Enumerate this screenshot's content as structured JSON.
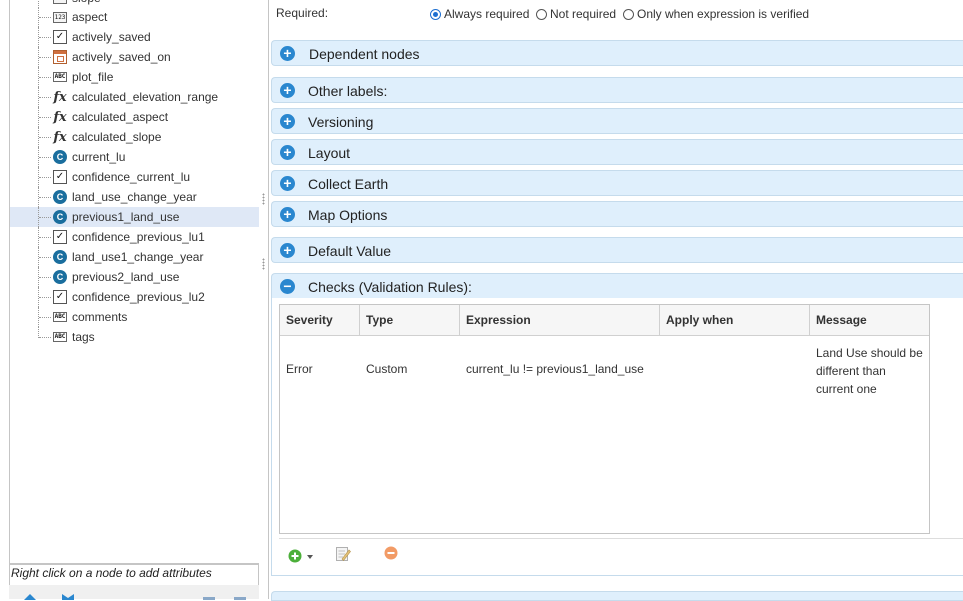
{
  "tree": {
    "items": [
      {
        "label": "slope",
        "icon": "number-icon"
      },
      {
        "label": "aspect",
        "icon": "number-icon"
      },
      {
        "label": "actively_saved",
        "icon": "checkbox-icon"
      },
      {
        "label": "actively_saved_on",
        "icon": "date-icon"
      },
      {
        "label": "plot_file",
        "icon": "text-icon"
      },
      {
        "label": "calculated_elevation_range",
        "icon": "fx-icon"
      },
      {
        "label": "calculated_aspect",
        "icon": "fx-icon"
      },
      {
        "label": "calculated_slope",
        "icon": "fx-icon"
      },
      {
        "label": "current_lu",
        "icon": "code-icon"
      },
      {
        "label": "confidence_current_lu",
        "icon": "checkbox-icon"
      },
      {
        "label": "land_use_change_year",
        "icon": "code-icon"
      },
      {
        "label": "previous1_land_use",
        "icon": "code-icon",
        "selected": true
      },
      {
        "label": "confidence_previous_lu1",
        "icon": "checkbox-icon"
      },
      {
        "label": "land_use1_change_year",
        "icon": "code-icon"
      },
      {
        "label": "previous2_land_use",
        "icon": "code-icon"
      },
      {
        "label": "confidence_previous_lu2",
        "icon": "checkbox-icon"
      },
      {
        "label": "comments",
        "icon": "text-icon"
      },
      {
        "label": "tags",
        "icon": "text-icon"
      }
    ],
    "icon_glyphs": {
      "number": "123",
      "text": "ABC",
      "fx": "fx",
      "code": "C",
      "check": "✓"
    },
    "status_text": "Right click on a node to add attributes"
  },
  "required": {
    "label": "Required:",
    "options": [
      {
        "label": "Always required",
        "checked": true
      },
      {
        "label": "Not required",
        "checked": false
      },
      {
        "label": "Only when expression is verified",
        "checked": false
      }
    ]
  },
  "sections": [
    {
      "label": "Dependent nodes",
      "expanded": false
    },
    {
      "label": "Other labels:",
      "expanded": false
    },
    {
      "label": "Versioning",
      "expanded": false
    },
    {
      "label": "Layout",
      "expanded": false
    },
    {
      "label": "Collect Earth",
      "expanded": false
    },
    {
      "label": "Map Options",
      "expanded": false
    },
    {
      "label": "Default Value",
      "expanded": false
    },
    {
      "label": "Checks (Validation Rules):",
      "expanded": true
    }
  ],
  "section_icons": {
    "expand": "+",
    "collapse": "−"
  },
  "checks": {
    "columns": [
      "Severity",
      "Type",
      "Expression",
      "Apply when",
      "Message"
    ],
    "rows": [
      {
        "severity": "Error",
        "type": "Custom",
        "expression": "current_lu != previous1_land_use",
        "apply_when": "",
        "message_lines": [
          "Land Use should be",
          "different than",
          "current one"
        ]
      }
    ]
  },
  "colors": {
    "accent": "#2a87cf",
    "header_bg": "#dfeffc",
    "selected_row": "#dfe8f6",
    "code_icon": "#1a6e9e",
    "add_green": "#4caf3a",
    "delete_orange": "#f08a4b"
  }
}
